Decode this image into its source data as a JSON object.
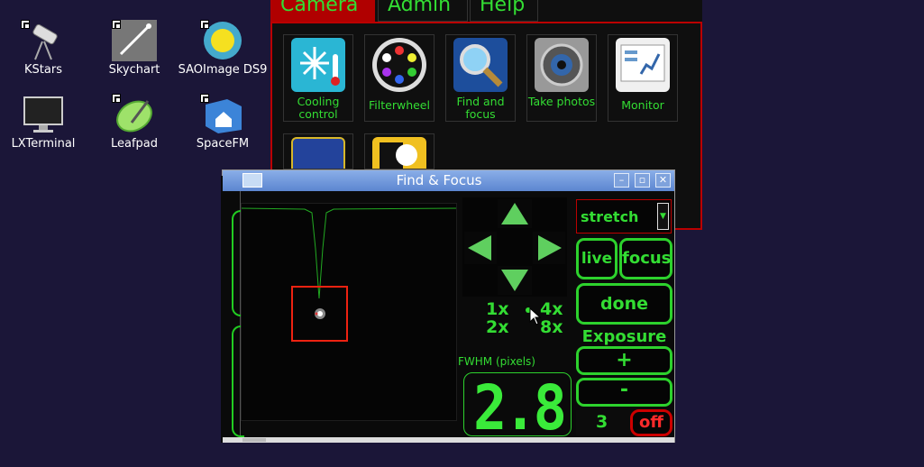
{
  "desktop": {
    "icons": [
      {
        "label": "KStars",
        "icon": "telescope-icon"
      },
      {
        "label": "Skychart",
        "icon": "comet-icon"
      },
      {
        "label": "SAOImage DS9",
        "icon": "sun-icon"
      },
      {
        "label": "LXTerminal",
        "icon": "monitor-icon"
      },
      {
        "label": "Leafpad",
        "icon": "leaf-pen-icon"
      },
      {
        "label": "SpaceFM",
        "icon": "home-folder-icon"
      }
    ]
  },
  "app": {
    "menus": [
      "Camera",
      "Admin",
      "Help"
    ],
    "active_menu": "Camera",
    "tools": [
      {
        "label": "Cooling control",
        "icon": "snowflake-thermometer-icon"
      },
      {
        "label": "Filterwheel",
        "icon": "filterwheel-icon"
      },
      {
        "label": "Find and focus",
        "icon": "magnifier-icon"
      },
      {
        "label": "Take photos",
        "icon": "camera-lens-icon"
      },
      {
        "label": "Monitor",
        "icon": "chart-monitor-icon"
      }
    ]
  },
  "finder": {
    "title": "Find & Focus",
    "stretch_value": "stretch",
    "live_label": "live",
    "focus_label": "focus",
    "done_label": "done",
    "zoom": {
      "z1": "1x",
      "z2": "2x",
      "z4": "4x",
      "z8": "8x"
    },
    "exposure_label": "Exposure",
    "plus_label": "+",
    "minus_label": "-",
    "exposure_value": "3",
    "off_label": "off",
    "fwhm_label": "FWHM (pixels)",
    "fwhm_value": "2.8"
  },
  "colors": {
    "accent": "#33dd33",
    "alert": "#cc0000",
    "desktop": "#1b1638"
  }
}
